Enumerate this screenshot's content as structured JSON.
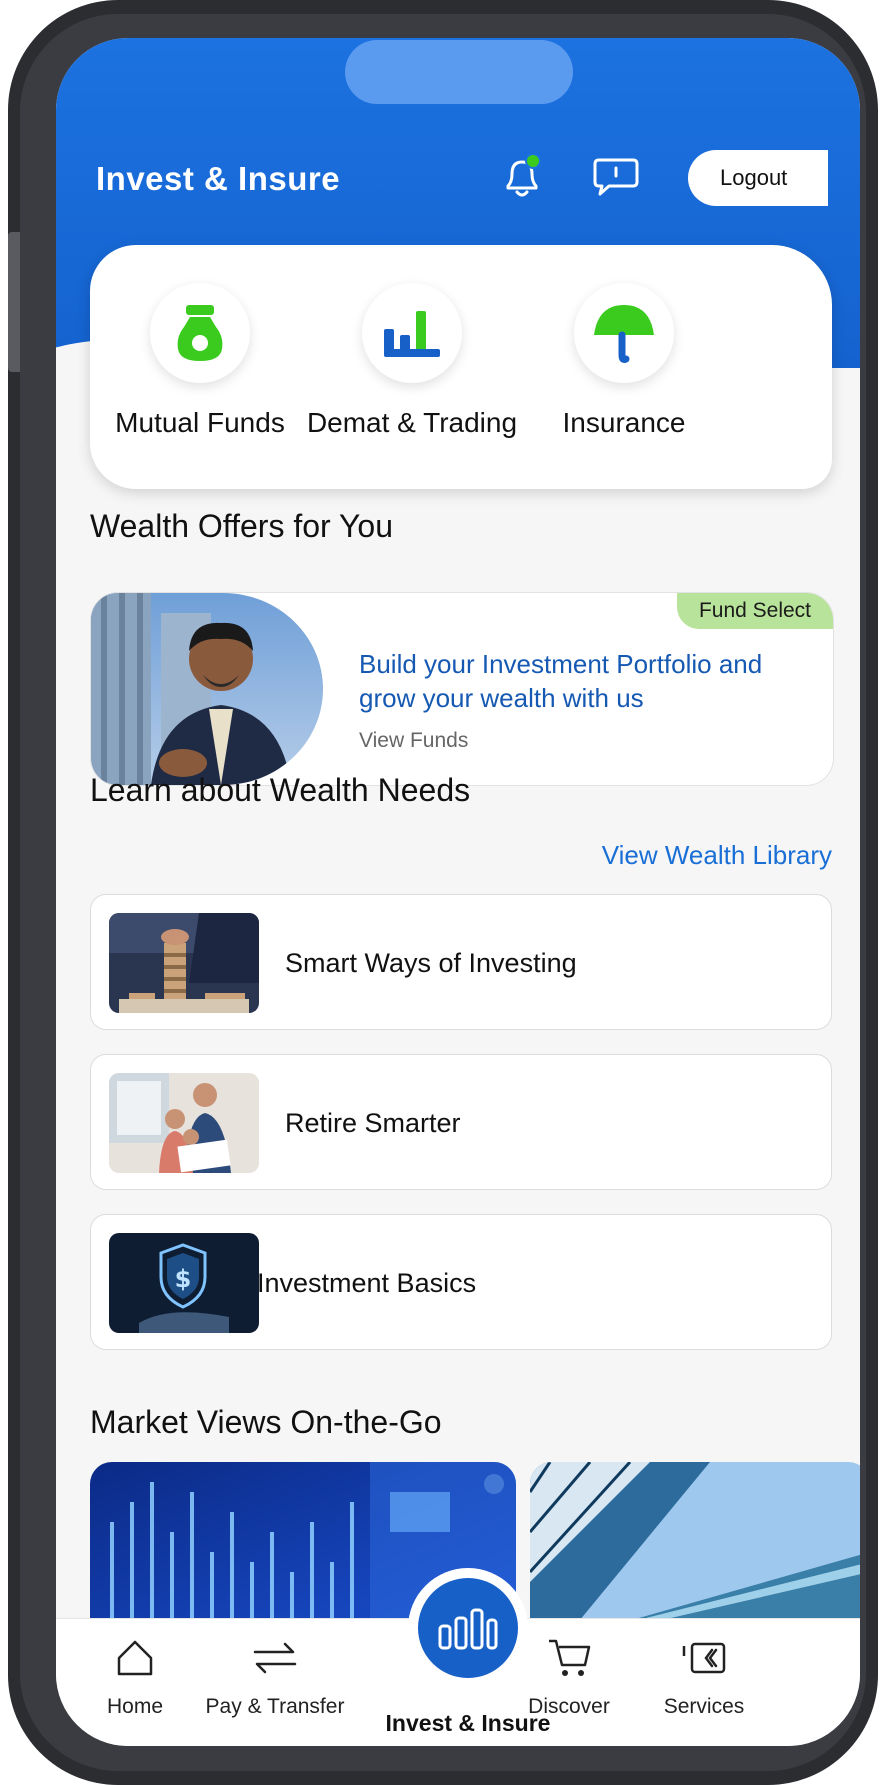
{
  "header": {
    "title": "Invest & Insure",
    "logout_label": "Logout"
  },
  "quick_links": [
    {
      "label": "Mutual Funds",
      "icon": "money-bag-icon"
    },
    {
      "label": "Demat & Trading",
      "icon": "bar-chart-icon"
    },
    {
      "label": "Insurance",
      "icon": "umbrella-icon"
    }
  ],
  "offers": {
    "title": "Wealth Offers for You",
    "card": {
      "badge": "Fund Select",
      "headline": "Build your Investment Portfolio and grow your wealth with us",
      "link": "View Funds"
    }
  },
  "learn": {
    "title": "Learn about Wealth Needs",
    "library_link": "View Wealth Library",
    "items": [
      {
        "label": "Smart Ways of Investing"
      },
      {
        "label": "Retire Smarter"
      },
      {
        "label": "Investment Basics"
      }
    ]
  },
  "market": {
    "title": "Market Views On-the-Go"
  },
  "nav": {
    "items": [
      {
        "label": "Home",
        "icon": "home-icon"
      },
      {
        "label": "Pay & Transfer",
        "icon": "transfer-icon"
      },
      {
        "label": "Invest & Insure",
        "icon": "invest-icon",
        "active": true
      },
      {
        "label": "Discover",
        "icon": "cart-icon"
      },
      {
        "label": "Services",
        "icon": "services-icon"
      }
    ]
  },
  "colors": {
    "brand_blue": "#1462cf",
    "accent_green": "#3bcb1f",
    "badge_green": "#b8e39a",
    "link_blue": "#1a6fd6"
  }
}
